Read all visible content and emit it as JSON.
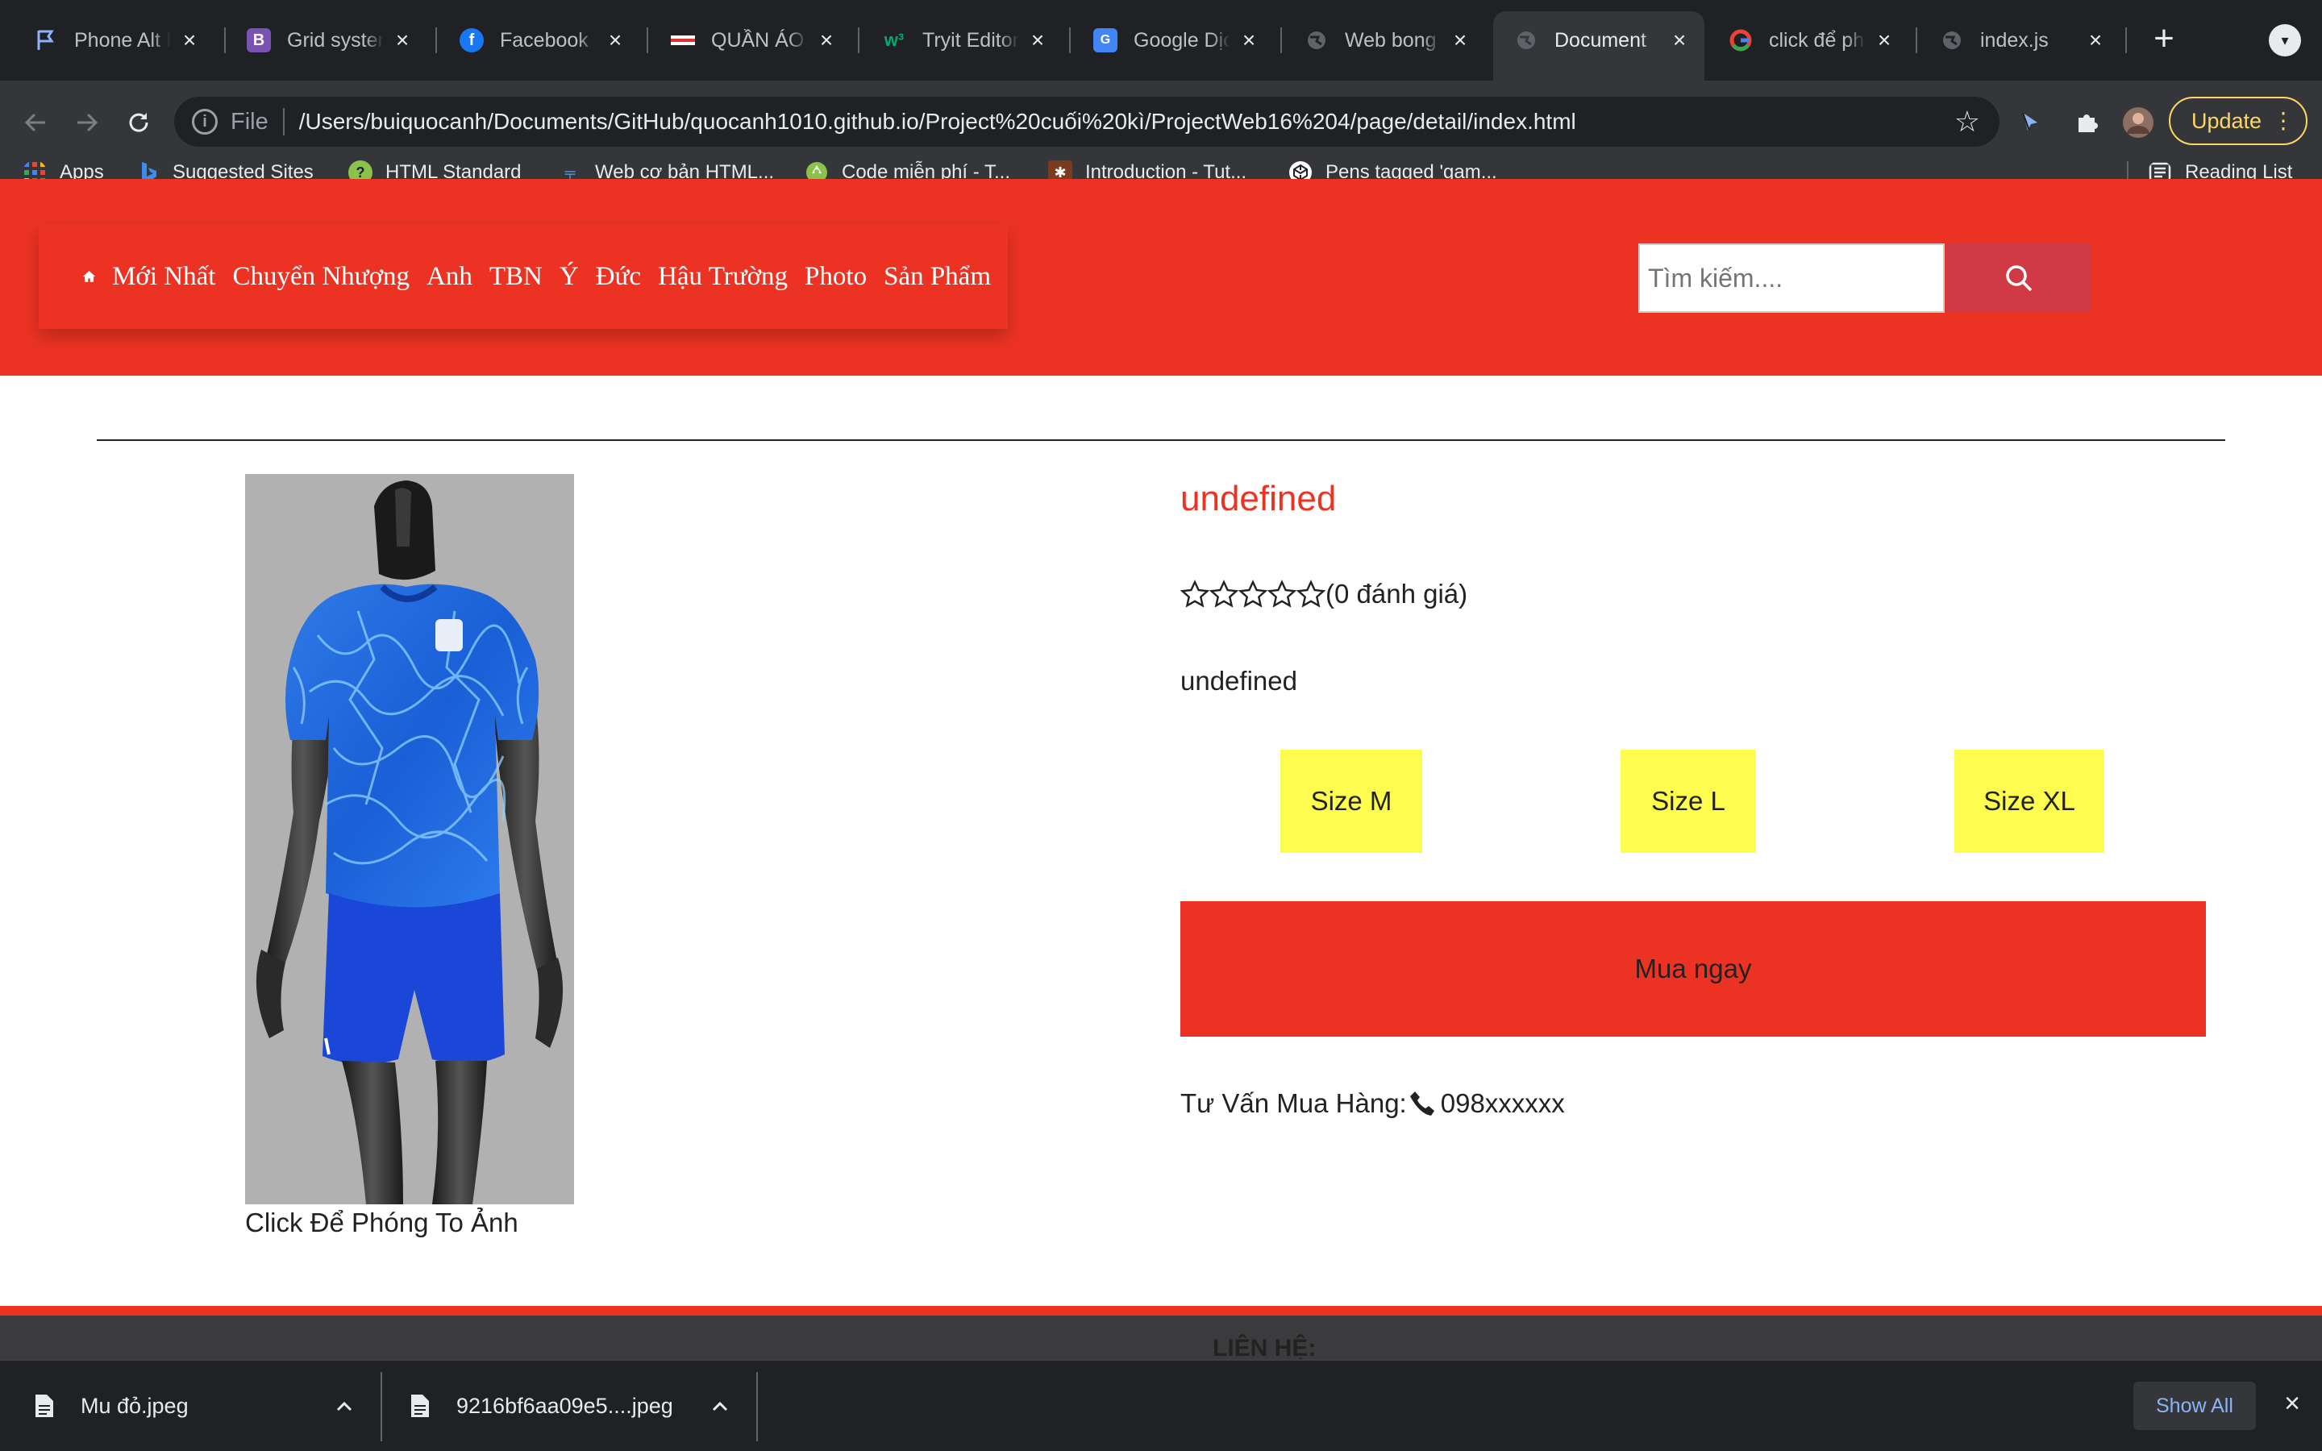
{
  "browser": {
    "tabs": [
      {
        "title": "Phone Alt Ic",
        "icon": "flag-icon"
      },
      {
        "title": "Grid system",
        "icon": "bootstrap-icon"
      },
      {
        "title": "Facebook",
        "icon": "facebook-icon"
      },
      {
        "title": "QUẦN ÁO B",
        "icon": "site-icon"
      },
      {
        "title": "Tryit Editor v",
        "icon": "w3schools-icon"
      },
      {
        "title": "Google Dịch",
        "icon": "google-translate-icon"
      },
      {
        "title": "Web bong đ",
        "icon": "globe-icon"
      },
      {
        "title": "Document",
        "icon": "globe-icon"
      },
      {
        "title": "click để phó",
        "icon": "google-icon"
      },
      {
        "title": "index.js",
        "icon": "globe-icon"
      }
    ],
    "new_tab": "+",
    "omnibox": {
      "scheme_label": "File",
      "url": "/Users/buiquocanh/Documents/GitHub/quocanh1010.github.io/Project%20cuối%20kì/ProjectWeb16%204/page/detail/index.html"
    },
    "update_label": "Update",
    "bookmarks": [
      {
        "label": "Apps"
      },
      {
        "label": "Suggested Sites"
      },
      {
        "label": "HTML Standard"
      },
      {
        "label": "Web cơ bản HTML..."
      },
      {
        "label": "Code miễn phí - T..."
      },
      {
        "label": "Introduction - Tut..."
      },
      {
        "label": "Pens tagged 'gam..."
      }
    ],
    "reading_list": "Reading List"
  },
  "header": {
    "menu": [
      "Mới Nhất",
      "Chuyển Nhượng",
      "Anh",
      "TBN",
      "Ý",
      "Đức",
      "Hậu Trường",
      "Photo",
      "Sản Phẩm"
    ],
    "search_placeholder": "Tìm kiếm...."
  },
  "product": {
    "name": "undefined",
    "rating_text": "(0 đánh giá)",
    "stars": 5,
    "description": "undefined",
    "sizes": [
      "Size M",
      "Size L",
      "Size XL"
    ],
    "buy_label": "Mua ngay",
    "hotline_label": "Tư Vấn Mua Hàng:",
    "hotline_number": "098xxxxxx",
    "zoom_caption": "Click Để Phóng To Ảnh"
  },
  "footer": {
    "title": "LIÊN HỆ:"
  },
  "downloads": {
    "items": [
      "Mu đỏ.jpeg",
      "9216bf6aa09e5....jpeg"
    ],
    "show_all": "Show All"
  },
  "colors": {
    "brand_red": "#ec3323",
    "size_yellow": "#fefc4f",
    "search_button": "#cf3a45",
    "chrome_dark": "#202124",
    "update_yellow": "#fdd663"
  }
}
